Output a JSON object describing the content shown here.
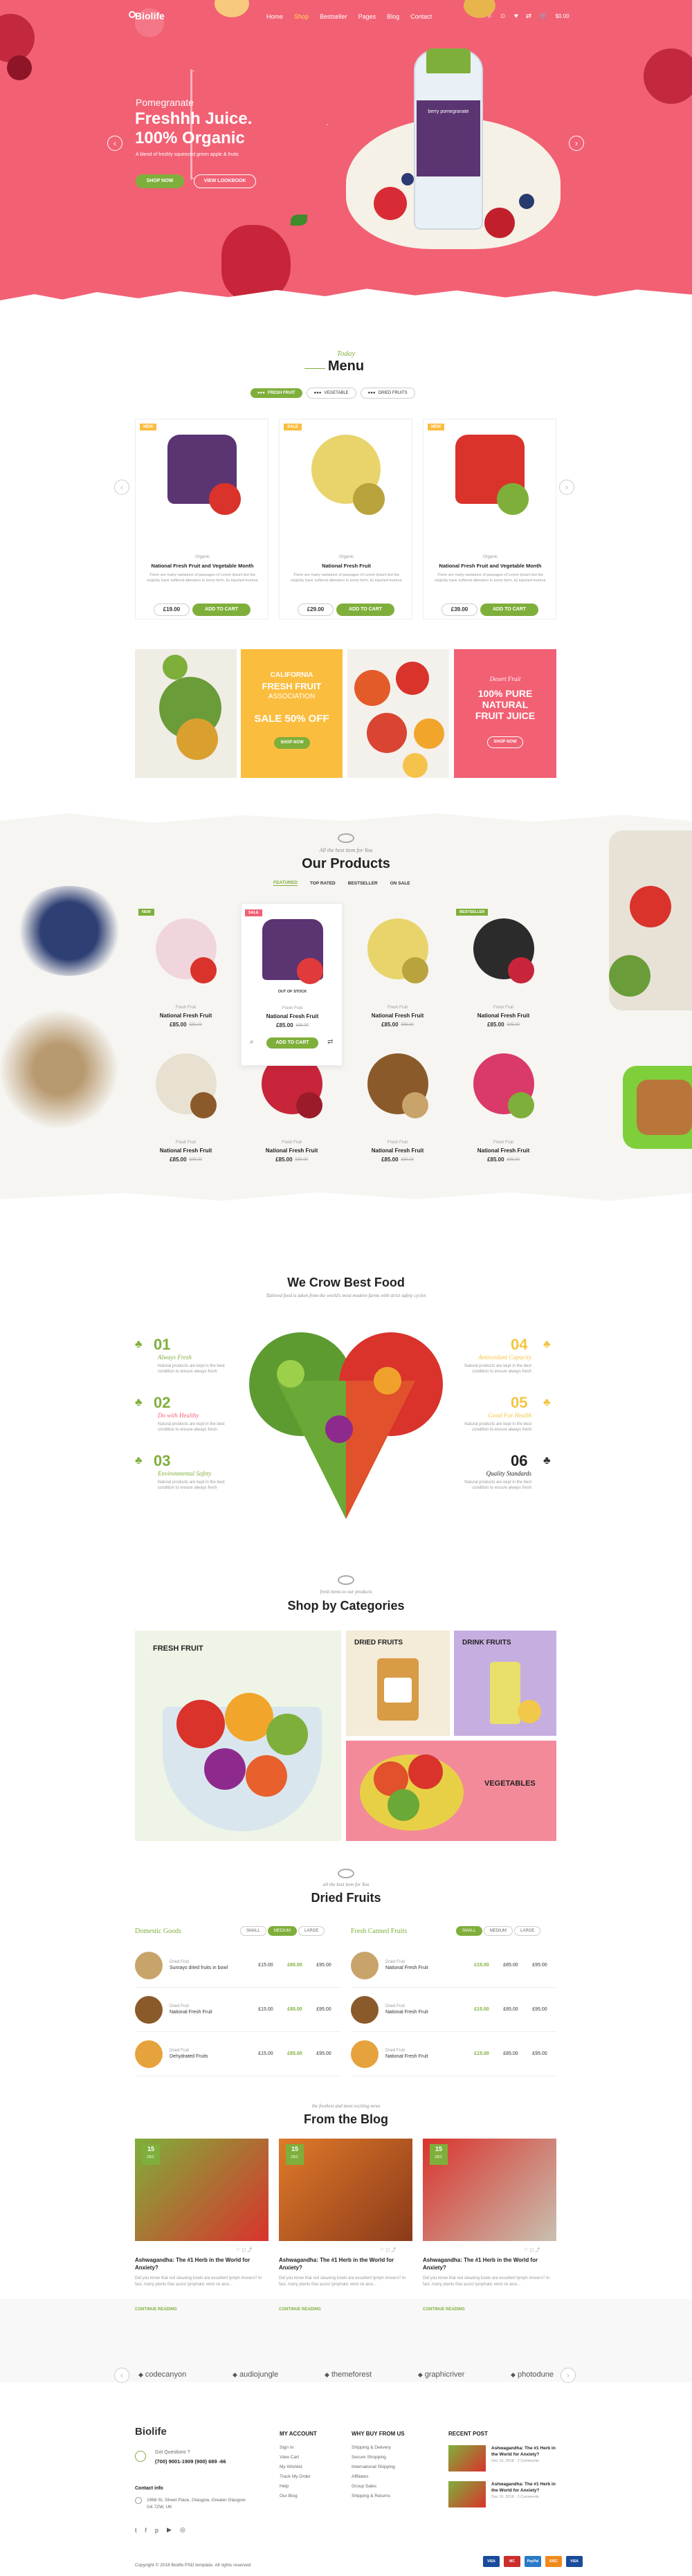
{
  "header": {
    "logo": "Biolife",
    "nav": [
      "Home",
      "Shop",
      "Bestseller",
      "Pages",
      "Blog",
      "Contact"
    ],
    "cart_price": "$0.00"
  },
  "hero": {
    "eyebrow": "Pomegranate",
    "title_line1": "Freshhh Juice.",
    "title_line2": "100% Organic",
    "desc": "A blend of freshly squeezed green apple & fruits",
    "btn1": "SHOP NOW",
    "btn2": "VIEW LOOKBOOK",
    "bottle_label": "berry pomegranate"
  },
  "menu": {
    "eyebrow": "Today",
    "title": "Menu",
    "tabs": [
      "FRESH FRUIT",
      "VEGETABLE",
      "DRIED FRUITS"
    ],
    "products": [
      {
        "badge": "NEW",
        "cat": "Organic",
        "name": "National Fresh Fruit and Vegetable Month",
        "desc": "There are many variations of passages of Lorem Ipsum but the majority have suffered alteration in some form, by injected humour",
        "price": "£19.00",
        "btn": "ADD TO CART"
      },
      {
        "badge": "SALE",
        "cat": "Organic",
        "name": "National Fresh Fruit",
        "desc": "There are many variations of passages of Lorem Ipsum but the majority have suffered alteration in some form, by injected humour",
        "price": "£29.00",
        "btn": "ADD TO CART"
      },
      {
        "badge": "NEW",
        "cat": "Organic",
        "name": "National Fresh Fruit and Vegetable Month",
        "desc": "There are many variations of passages of Lorem Ipsum but the majority have suffered alteration in some form, by injected humour",
        "price": "£39.00",
        "btn": "ADD TO CART"
      }
    ]
  },
  "banners": {
    "b2_line1": "CALIFORNIA",
    "b2_line2": "FRESH FRUIT",
    "b2_line3": "ASSOCIATION",
    "b2_sale": "SALE 50% OFF",
    "b2_btn": "SHOP NOW",
    "b4_eyebrow": "Desert Fruit",
    "b4_line1": "100% PURE",
    "b4_line2": "NATURAL",
    "b4_line3": "FRUIT JUICE",
    "b4_btn": "SHOP NOW"
  },
  "our_products": {
    "eyebrow": "All the best item for You",
    "title": "Our Products",
    "tabs": [
      "FEATURED",
      "TOP RATED",
      "BESTSELLER",
      "ON SALE"
    ],
    "items": [
      {
        "badge": "NEW",
        "cat": "Fresh Fruit",
        "name": "National Fresh Fruit",
        "price": "£85.00",
        "old": "£95.00"
      },
      {
        "badge": "SALE",
        "cat": "Fresh Fruit",
        "name": "National Fresh Fruit",
        "price": "£85.00",
        "old": "£95.00",
        "stock": "OUT OF STOCK",
        "btn": "ADD TO CART"
      },
      {
        "badge": "",
        "cat": "Fresh Fruit",
        "name": "National Fresh Fruit",
        "price": "£85.00",
        "old": "£95.00"
      },
      {
        "badge": "BESTSELLER",
        "cat": "Fresh Fruit",
        "name": "National Fresh Fruit",
        "price": "£85.00",
        "old": "£95.00"
      },
      {
        "badge": "",
        "cat": "Fresh Fruit",
        "name": "National Fresh Fruit",
        "price": "£85.00",
        "old": "£95.00"
      },
      {
        "badge": "",
        "cat": "Fresh Fruit",
        "name": "National Fresh Fruit",
        "price": "£85.00",
        "old": "£95.00"
      },
      {
        "badge": "",
        "cat": "Fresh Fruit",
        "name": "National Fresh Fruit",
        "price": "£85.00",
        "old": "£95.00"
      },
      {
        "badge": "",
        "cat": "Fresh Fruit",
        "name": "National Fresh Fruit",
        "price": "£85.00",
        "old": "£95.00"
      }
    ]
  },
  "crow": {
    "title": "We Crow Best Food",
    "sub": "Tailored food is taken from the world's most modern farms with strict safety cycles",
    "left": [
      {
        "num": "01",
        "label": "Always Fresh"
      },
      {
        "num": "02",
        "label": "Do with Healthy"
      },
      {
        "num": "03",
        "label": "Environmental Safety"
      }
    ],
    "right": [
      {
        "num": "04",
        "label": "Antioxidant Capacity"
      },
      {
        "num": "05",
        "label": "Good For Health"
      },
      {
        "num": "06",
        "label": "Quality Standards"
      }
    ],
    "desc": "Natural products are kept in the best condition to ensure always fresh"
  },
  "categories": {
    "eyebrow": "fresh items to our products",
    "title": "Shop by Categories",
    "c1": "FRESH FRUIT",
    "c2": "DRIED FRUITS",
    "c3": "DRINK FRUITS",
    "c4": "VEGETABLES"
  },
  "dried": {
    "eyebrow": "all the best item for You",
    "title": "Dried Fruits",
    "left_title": "Domestic Goods",
    "right_title": "Fresh Canned Fruits",
    "sizes": [
      "SMALL",
      "MEDIUM",
      "LARGE"
    ],
    "left_rows": [
      {
        "cat": "Dried Fruit",
        "name": "Sunrays dried fruits in bowl",
        "p": [
          "£15.00",
          "£85.00",
          "£95.00"
        ]
      },
      {
        "cat": "Dried Fruit",
        "name": "National Fresh Fruit",
        "p": [
          "£15.00",
          "£85.00",
          "£95.00"
        ]
      },
      {
        "cat": "Dried Fruit",
        "name": "Dehydrated Fruits",
        "p": [
          "£15.00",
          "£85.00",
          "£95.00"
        ]
      }
    ],
    "right_rows": [
      {
        "cat": "Dried Fruit",
        "name": "National Fresh Fruit",
        "p": [
          "£15.00",
          "£85.00",
          "£95.00"
        ]
      },
      {
        "cat": "Dried Fruit",
        "name": "National Fresh Fruit",
        "p": [
          "£15.00",
          "£85.00",
          "£95.00"
        ]
      },
      {
        "cat": "Dried Fruit",
        "name": "National Fresh Fruit",
        "p": [
          "£15.00",
          "£85.00",
          "£95.00"
        ]
      }
    ]
  },
  "blog": {
    "eyebrow": "the freshest and most exciting news",
    "title": "From the Blog",
    "posts": [
      {
        "day": "15",
        "mon": "DEC",
        "title": "Ashwagandha: The #1 Herb in the World for Anxiety?",
        "excerpt": "Did you know that red cleaning foods are excellent lymph movers? In fact, many plants that assist lymphatic work ok also...",
        "more": "CONTINUE READING"
      },
      {
        "day": "15",
        "mon": "DEC",
        "title": "Ashwagandha: The #1 Herb in the World for Anxiety?",
        "excerpt": "Did you know that red cleaning foods are excellent lymph movers? In fact, many plants that assist lymphatic work ok also...",
        "more": "CONTINUE READING"
      },
      {
        "day": "15",
        "mon": "DEC",
        "title": "Ashwagandha: The #1 Herb in the World for Anxiety?",
        "excerpt": "Did you know that red cleaning foods are excellent lymph movers? In fact, many plants that assist lymphatic work ok also...",
        "more": "CONTINUE READING"
      }
    ]
  },
  "brands": [
    "codecanyon",
    "audiojungle",
    "themeforest",
    "graphicriver",
    "photodune"
  ],
  "footer": {
    "logo": "Biolife",
    "q": "Got Questions ?",
    "phone": "(700) 9001-1909 (900) 689 -66",
    "contact_h": "Contact info",
    "addr": "1968 St, Street Place, Glasgow, Greater Glasgow G4 7ZW, UK",
    "acc_h": "MY ACCOUNT",
    "acc": [
      "Sign In",
      "View Cart",
      "My Wishlist",
      "Track My Order",
      "Help",
      "Our Blog"
    ],
    "why_h": "WHY BUY FROM US",
    "why": [
      "Shipping & Delivery",
      "Secure Shopping",
      "International Shipping",
      "Affiliates",
      "Group Sales",
      "Shipping & Returns"
    ],
    "recent_h": "RECENT POST",
    "recent": [
      {
        "t": "Ashwagandha: The #1 Herb in the World for Anxiety?",
        "d": "Dec 15, 2018 · 2 Comments"
      },
      {
        "t": "Ashwagandha: The #1 Herb in the World for Anxiety?",
        "d": "Dec 15, 2018 · 2 Comments"
      }
    ],
    "copy": "Copyright © 2018 Biolife PSD template. All rights reserved",
    "pay": [
      "VISA",
      "MC",
      "PayPal",
      "DISC",
      "VISA"
    ]
  }
}
